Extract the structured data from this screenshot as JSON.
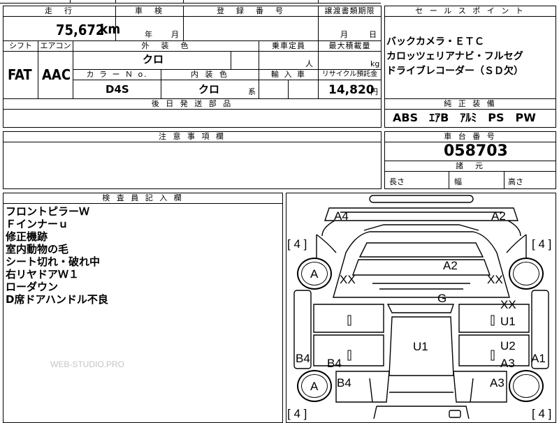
{
  "top_strip": {
    "left_text": "",
    "mid_text": "",
    "right_text": ""
  },
  "headers": {
    "mileage": "走　行",
    "shaken": "車　検",
    "registration": "登　録　番　号",
    "transfer_deadline": "譲渡書類期限",
    "shift": "シフト",
    "aircon": "エアコン",
    "exterior_color": "外　装　色",
    "capacity": "乗車定員",
    "max_load": "最大積載量",
    "color_no": "カ ラ ー Ｎ o.",
    "interior_color": "内 装 色",
    "import": "輸 入 車",
    "recycle": "リサイクル預託金",
    "later_parts": "後 日 発 送 部 品",
    "sales_points": "セ ー ル ス ポ イ ン ト",
    "factory_equipment": "純 正 装 備",
    "caution": "注 意 事 項 欄",
    "chassis_no": "車 台 番 号",
    "dimensions": "諸　元",
    "inspector_notes": "検 査 員 記 入 欄"
  },
  "values": {
    "mileage": "75,672",
    "mileage_unit": "km",
    "shaken_year_unit": "年",
    "shaken_month_unit": "月",
    "transfer_month_unit": "月",
    "transfer_day_unit": "日",
    "shift": "FAT",
    "aircon": "AAC",
    "exterior_color": "クロ",
    "capacity_unit": "人",
    "max_load_unit": "kg",
    "color_no": "D4S",
    "interior_color": "クロ",
    "interior_color_suffix": "系",
    "recycle_fee": "14,820",
    "recycle_unit": "円",
    "chassis_no": "058703",
    "dim_length": "長さ",
    "dim_width": "幅",
    "dim_height": "高さ"
  },
  "sales_points": [
    "バックカメラ・ＥＴＣ",
    "カロッツェリアナビ・フルセグ",
    "ドライブレコーダー（ＳＤ欠）"
  ],
  "factory_equipment": "ABS　ｴｱB　ｱﾙﾐ　PS　PW",
  "inspector_notes": [
    "フロントピラーＷ",
    "Ｆインナーｕ",
    "修正機跡",
    "室内動物の毛",
    "シート切れ・破れ中",
    "右リヤドアＷ１",
    "ローダウン",
    "D席ドアハンドル不良"
  ],
  "watermark": "WEB-STUDIO.PRO",
  "diagram": {
    "codes": {
      "a4": "A4",
      "a2_top_right": "A2",
      "a2_roof": "A2",
      "g": "G",
      "xx_left": "XX",
      "xx_right": "XX",
      "xx_rear_right": "XX",
      "u1_right": "U1",
      "u1_center": "U1",
      "u2_right": "U2",
      "b4_left_edge": "B4",
      "b4_left_door": "B4",
      "b4_left_rear": "B4",
      "a3_right_door": "A3",
      "a3_right_rear": "A3",
      "a1_right_edge": "A1"
    },
    "tread": {
      "top_left": "4",
      "top_right": "4",
      "bottom_left": "4",
      "bottom_right": "4"
    },
    "tires": {
      "front_left": "A",
      "rear_left": "A"
    }
  }
}
